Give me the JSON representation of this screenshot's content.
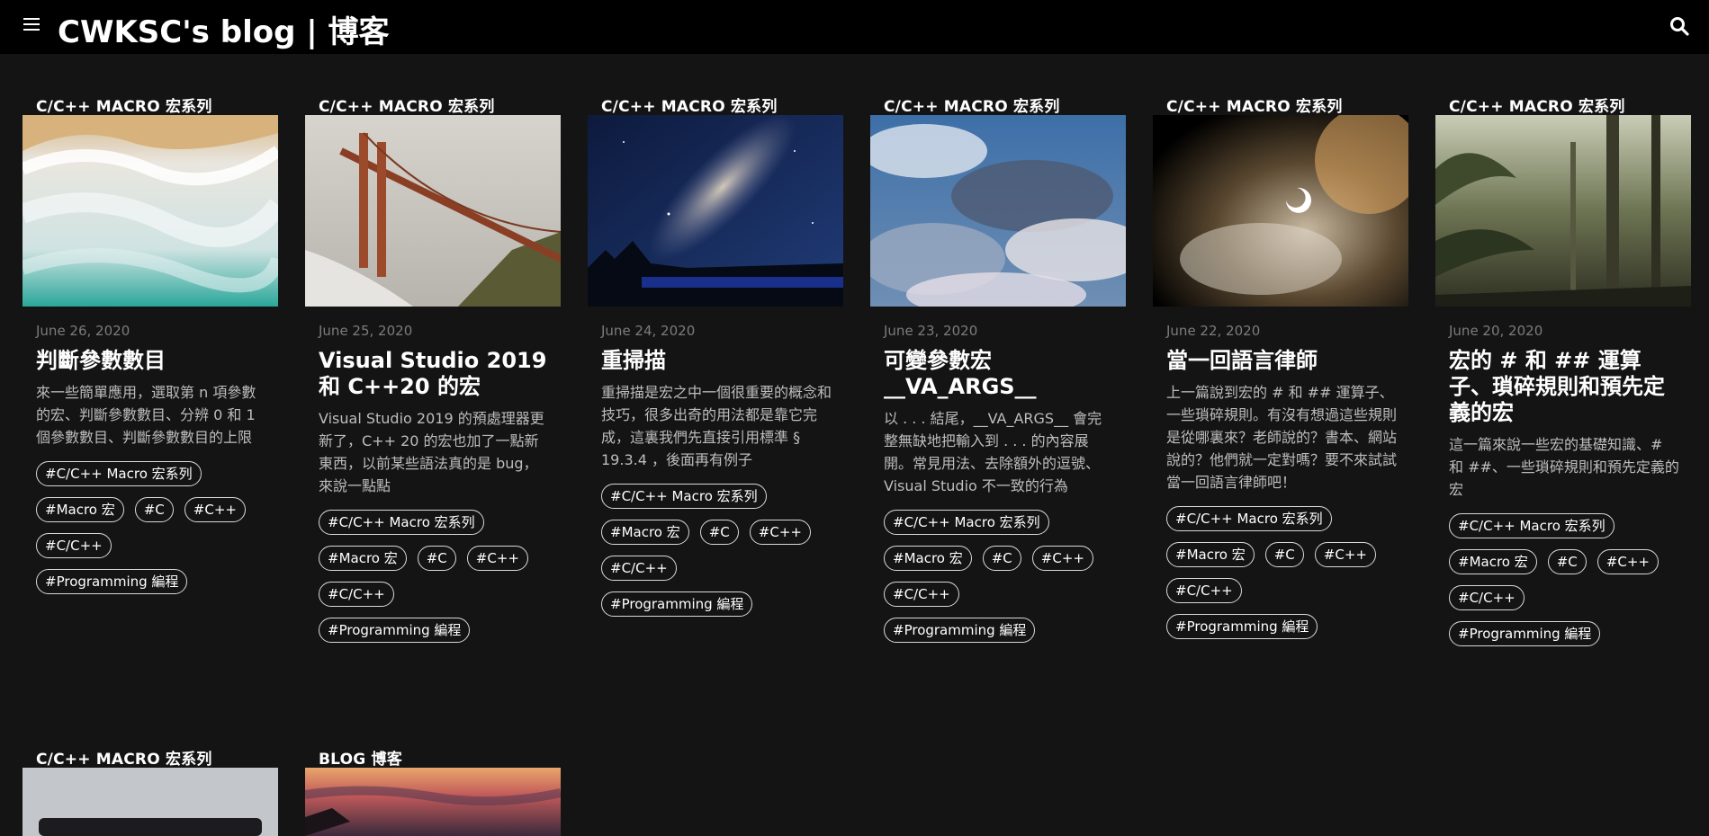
{
  "header": {
    "title": "CWKSC's blog | 博客",
    "menu_icon": "hamburger-menu-icon",
    "search_icon": "search-icon"
  },
  "posts": [
    {
      "category": "C/C++ MACRO 宏系列",
      "date": "June 26, 2020",
      "title": "判斷參數數目",
      "excerpt": "來一些簡單應用，選取第 n 項參數的宏、判斷參數數目、分辨 0 和 1 個參數數目、判斷參數數目的上限",
      "tags": [
        "#C/C++ Macro 宏系列",
        "#Macro 宏",
        "#C",
        "#C++",
        "#C/C++",
        "#Programming 編程"
      ],
      "image": "ocean-waves-aerial"
    },
    {
      "category": "C/C++ MACRO 宏系列",
      "date": "June 25, 2020",
      "title": "Visual Studio 2019 和 C++20 的宏",
      "excerpt": "Visual Studio 2019 的預處理器更新了，C++ 20 的宏也加了一點新東西，以前某些語法真的是 bug，來說一點點",
      "tags": [
        "#C/C++ Macro 宏系列",
        "#Macro 宏",
        "#C",
        "#C++",
        "#C/C++",
        "#Programming 編程"
      ],
      "image": "golden-gate-bridge-fog"
    },
    {
      "category": "C/C++ MACRO 宏系列",
      "date": "June 24, 2020",
      "title": "重掃描",
      "excerpt": "重掃描是宏之中一個很重要的概念和技巧，很多出奇的用法都是靠它完成，這裏我們先直接引用標準 § 19.3.4 ，後面再有例子",
      "tags": [
        "#C/C++ Macro 宏系列",
        "#Macro 宏",
        "#C",
        "#C++",
        "#C/C++",
        "#Programming 編程"
      ],
      "image": "milky-way-night-sky"
    },
    {
      "category": "C/C++ MACRO 宏系列",
      "date": "June 23, 2020",
      "title": "可變參數宏 __VA_ARGS__",
      "excerpt": "以 . . . 結尾，__VA_ARGS__ 會完整無缺地把輸入到 . . . 的內容展開。常見用法、去除額外的逗號、Visual Studio 不一致的行為",
      "tags": [
        "#C/C++ Macro 宏系列",
        "#Macro 宏",
        "#C",
        "#C++",
        "#C/C++",
        "#Programming 編程"
      ],
      "image": "cloudy-blue-sky"
    },
    {
      "category": "C/C++ MACRO 宏系列",
      "date": "June 22, 2020",
      "title": "當一回語言律師",
      "excerpt": "上一篇說到宏的 # 和 ## 運算子、一些瑣碎規則。有沒有想過這些規則是從哪裏來？老師說的？書本、網站說的？他們就一定對嗎？要不來試試當一回語言律師吧！",
      "tags": [
        "#C/C++ Macro 宏系列",
        "#Macro 宏",
        "#C",
        "#C++",
        "#C/C++",
        "#Programming 編程"
      ],
      "image": "eclipse-smoke"
    },
    {
      "category": "C/C++ MACRO 宏系列",
      "date": "June 20, 2020",
      "title": "宏的 # 和 ## 運算子、瑣碎規則和預先定義的宏",
      "excerpt": "這一篇來說一些宏的基礎知識、# 和 ##、一些瑣碎規則和預先定義的宏",
      "tags": [
        "#C/C++ Macro 宏系列",
        "#Macro 宏",
        "#C",
        "#C++",
        "#C/C++",
        "#Programming 編程"
      ],
      "image": "jungle-forest"
    },
    {
      "category": "C/C++ MACRO 宏系列",
      "image": "laptop-grey"
    },
    {
      "category": "BLOG 博客",
      "image": "sunset-sea"
    }
  ]
}
